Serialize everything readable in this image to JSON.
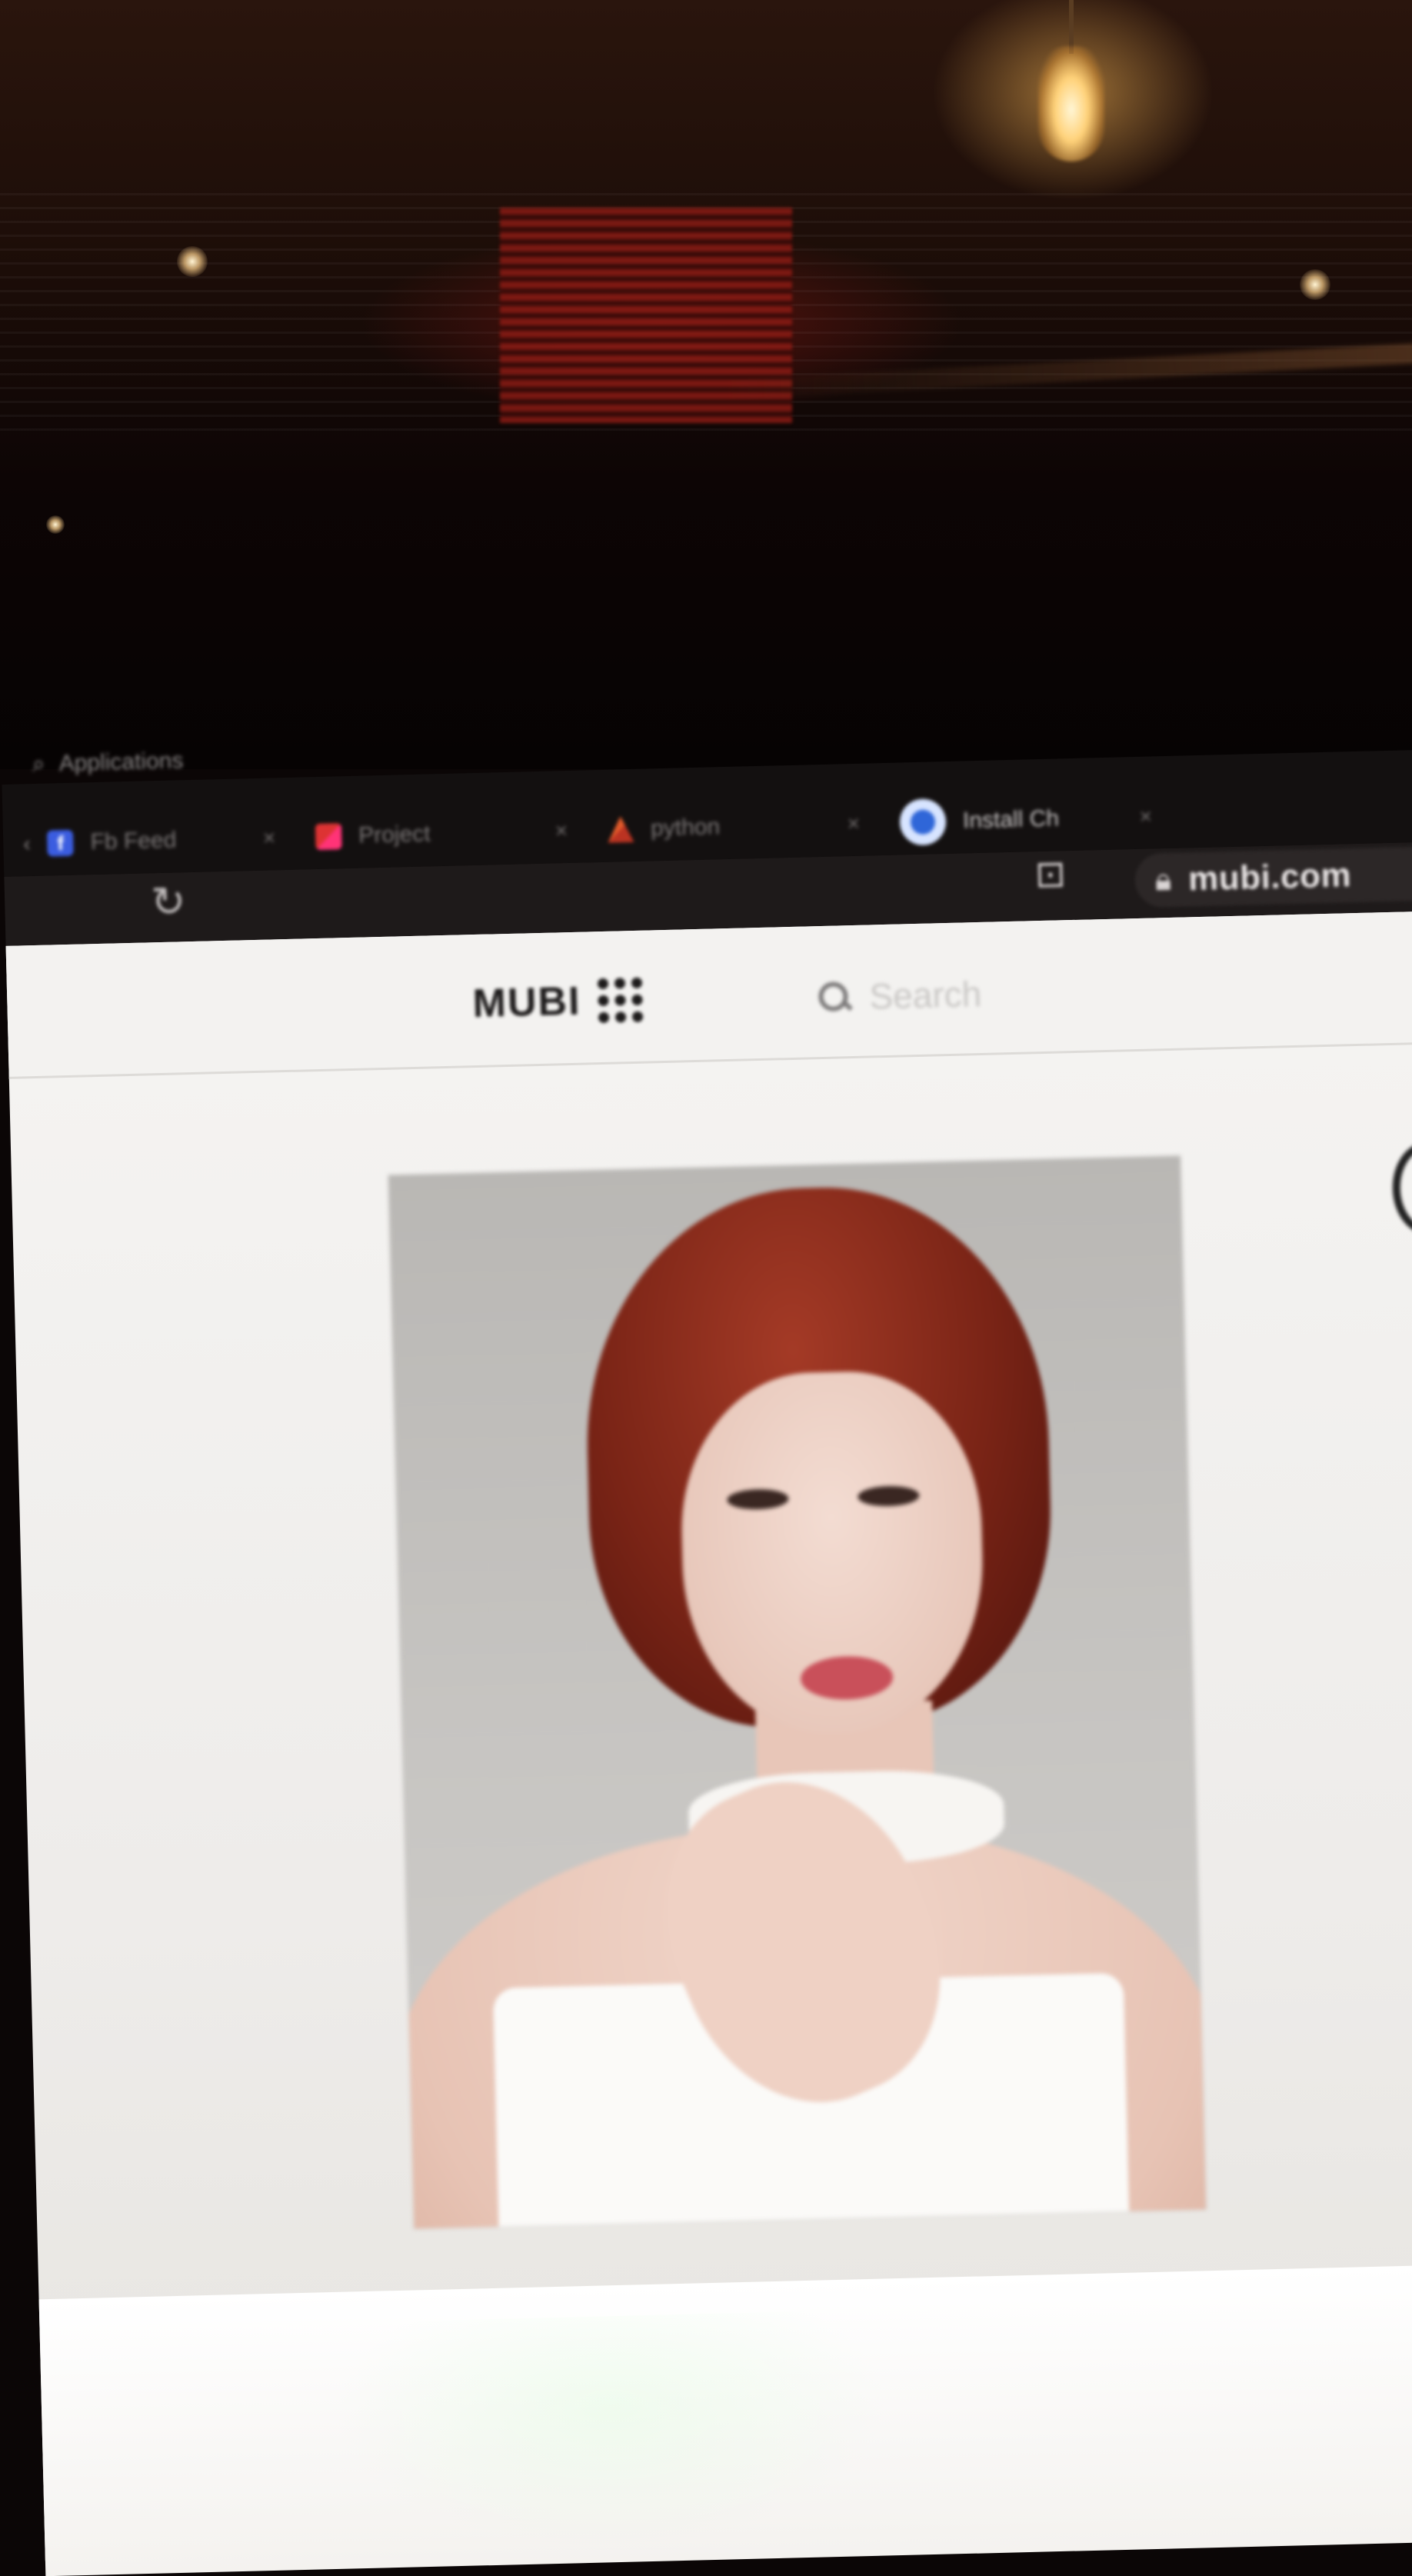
{
  "browser": {
    "apps_label": "Applications",
    "tabs": [
      {
        "label": "Fb Feed",
        "icon": "facebook-icon"
      },
      {
        "label": "Project",
        "icon": "project-icon"
      },
      {
        "label": "python",
        "icon": "python-icon"
      },
      {
        "label": "Install Ch",
        "icon": "chrome-icon",
        "active": true
      }
    ],
    "tab_close": "×",
    "url": "mubi.com"
  },
  "site": {
    "logo_text": "MUBI",
    "search_placeholder": "Search"
  },
  "colors": {
    "page_bg": "#f5f4f2",
    "tabbar_bg": "#131010",
    "toolbar_bg": "#1e1a1a",
    "logo": "#1d1b1b",
    "chrome_blue": "#2f66d8"
  }
}
